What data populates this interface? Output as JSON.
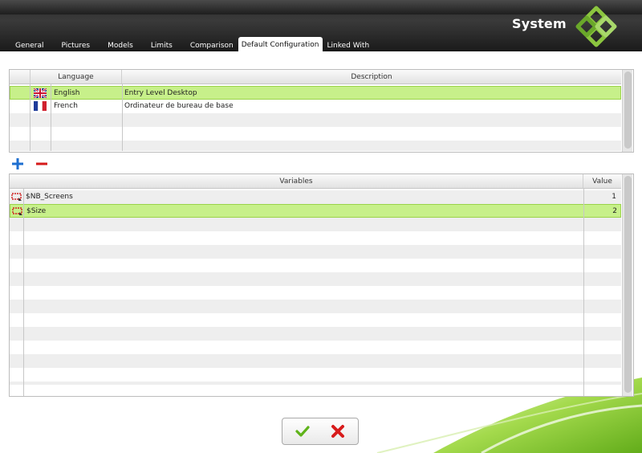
{
  "window": {
    "title": "System"
  },
  "tabs": [
    {
      "label": "General"
    },
    {
      "label": "Pictures"
    },
    {
      "label": "Models"
    },
    {
      "label": "Limits"
    },
    {
      "label": "Comparison"
    },
    {
      "label": "Default Configuration",
      "active": true
    },
    {
      "label": "Linked With"
    }
  ],
  "languages": {
    "headers": {
      "language": "Language",
      "description": "Description"
    },
    "rows": [
      {
        "flag": "uk-flag-icon",
        "language": "English",
        "description": "Entry Level Desktop",
        "selected": true
      },
      {
        "flag": "france-flag-icon",
        "language": "French",
        "description": "Ordinateur de bureau de base",
        "selected": false
      }
    ]
  },
  "toolbar": {
    "add": "add-icon",
    "remove": "remove-icon"
  },
  "variables": {
    "headers": {
      "variables": "Variables",
      "value": "Value"
    },
    "rows": [
      {
        "name": "$NB_Screens",
        "value": "1",
        "selected": false
      },
      {
        "name": "$Size",
        "value": "2",
        "selected": true
      }
    ]
  },
  "actions": {
    "ok": "checkmark-icon",
    "cancel": "cross-icon"
  },
  "colors": {
    "selection": "#c7f08a",
    "accent": "#7cc41c",
    "header_bg": "#2a2a2a"
  }
}
